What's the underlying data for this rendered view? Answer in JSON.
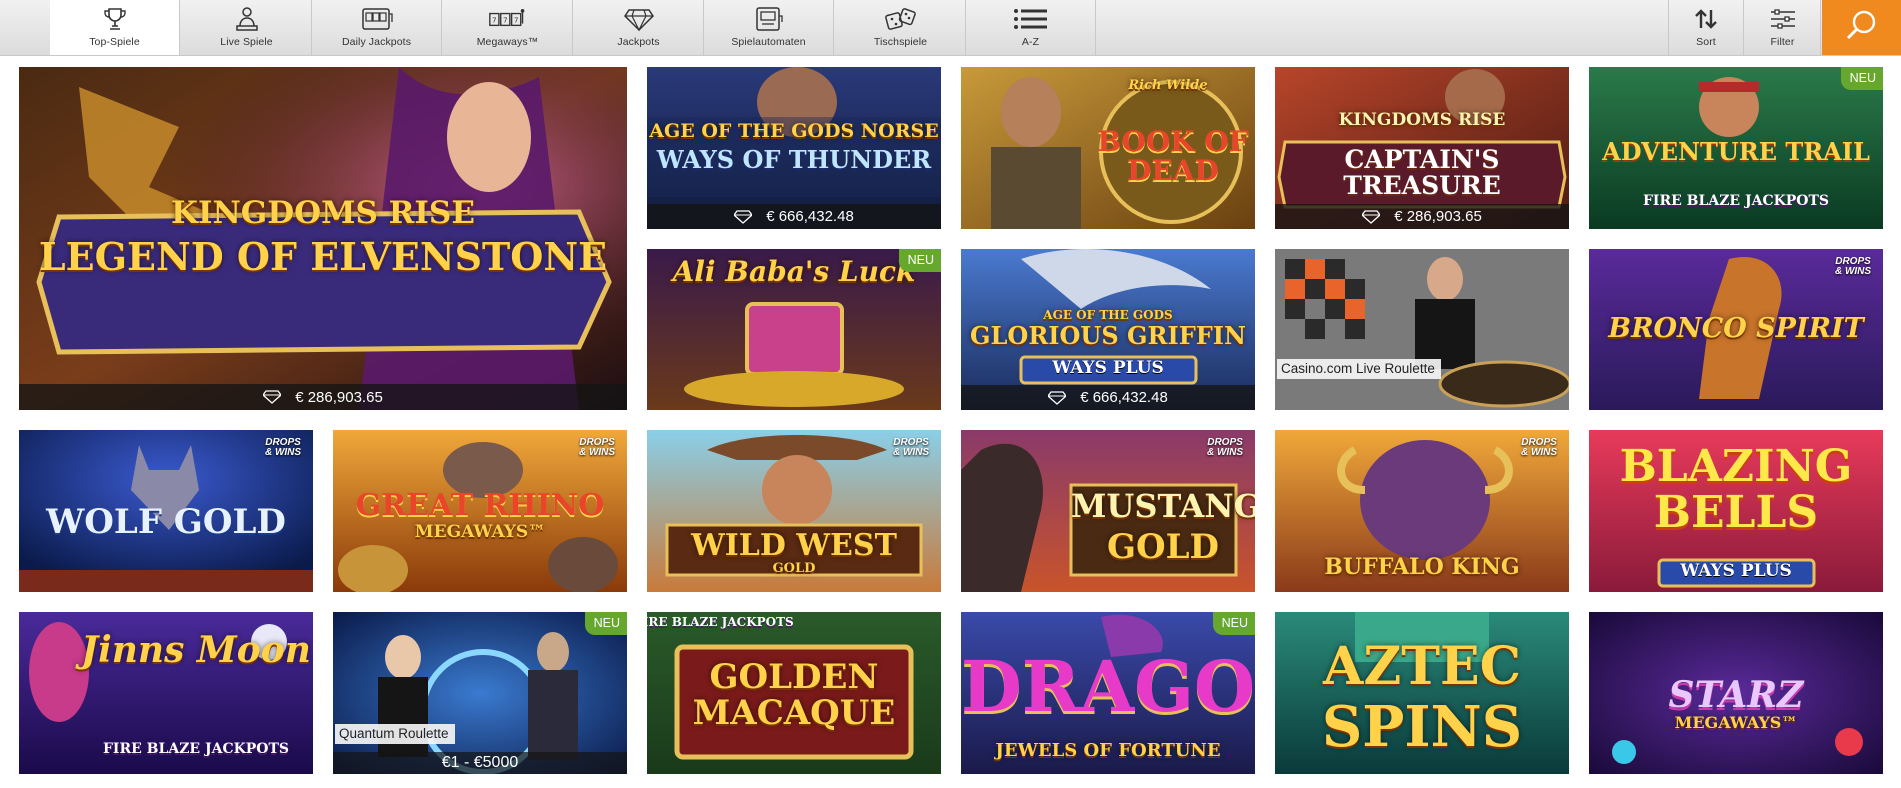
{
  "nav": {
    "tabs": [
      {
        "label": "Top-Spiele",
        "icon": "trophy-icon",
        "active": true
      },
      {
        "label": "Live Spiele",
        "icon": "dealer-icon",
        "active": false
      },
      {
        "label": "Daily Jackpots",
        "icon": "slot-machine-icon",
        "active": false
      },
      {
        "label": "Megaways™",
        "icon": "reels-icon",
        "active": false
      },
      {
        "label": "Jackpots",
        "icon": "diamond-icon",
        "active": false
      },
      {
        "label": "Spielautomaten",
        "icon": "slot-icon",
        "active": false
      },
      {
        "label": "Tischspiele",
        "icon": "dice-icon",
        "active": false
      },
      {
        "label": "A-Z",
        "icon": "list-icon",
        "active": false
      }
    ],
    "sort_label": "Sort",
    "filter_label": "Filter",
    "search_icon": "search-icon",
    "accent": "#f08a1e"
  },
  "games": [
    {
      "title": "KINGDOMS RISE",
      "subtitle": "LEGEND OF ELVENSTONE",
      "jackpot": "€ 286,903.65"
    },
    {
      "title": "AGE OF THE GODS NORSE",
      "subtitle": "WAYS OF THUNDER",
      "jackpot": "€ 666,432.48"
    },
    {
      "title": "Rich Wilde",
      "subtitle": "BOOK OF DEAD"
    },
    {
      "title": "KINGDOMS RISE",
      "subtitle": "CAPTAIN'S TREASURE",
      "jackpot": "€ 286,903.65"
    },
    {
      "title": "ADVENTURE TRAIL",
      "subtitle": "FIRE BLAZE JACKPOTS",
      "badge": "NEU"
    },
    {
      "title": "Ali Baba's Luck",
      "badge": "NEU"
    },
    {
      "title": "AGE OF THE GODS",
      "subtitle": "GLORIOUS GRIFFIN",
      "extra": "WAYS PLUS",
      "jackpot": "€ 666,432.48"
    },
    {
      "live_label": "Casino.com Live Roulette"
    },
    {
      "title": "BRONCO SPIRIT",
      "drops": "DROPS & WINS"
    },
    {
      "title": "WOLF GOLD",
      "drops": "DROPS & WINS"
    },
    {
      "title": "GREAT RHINO",
      "subtitle": "MEGAWAYS™",
      "drops": "DROPS & WINS"
    },
    {
      "title": "WILD WEST",
      "subtitle": "GOLD",
      "drops": "DROPS & WINS"
    },
    {
      "title": "MUSTANG",
      "subtitle": "GOLD",
      "drops": "DROPS & WINS"
    },
    {
      "title": "BUFFALO KING",
      "drops": "DROPS & WINS"
    },
    {
      "title": "BLAZING BELLS",
      "subtitle": "WAYS PLUS"
    },
    {
      "title": "Jinns Moon",
      "subtitle": "FIRE BLAZE JACKPOTS"
    },
    {
      "live_label": "Quantum Roulette",
      "range": "€1 - €5000",
      "badge": "NEU"
    },
    {
      "title": "GOLDEN MACAQUE",
      "subtitle": "FIRE BLAZE JACKPOTS"
    },
    {
      "title": "DRAGO",
      "subtitle": "JEWELS OF FORTUNE",
      "badge": "NEU"
    },
    {
      "title": "AZTEC",
      "subtitle": "SPINS"
    },
    {
      "title": "STARZ",
      "subtitle": "MEGAWAYS™"
    }
  ]
}
